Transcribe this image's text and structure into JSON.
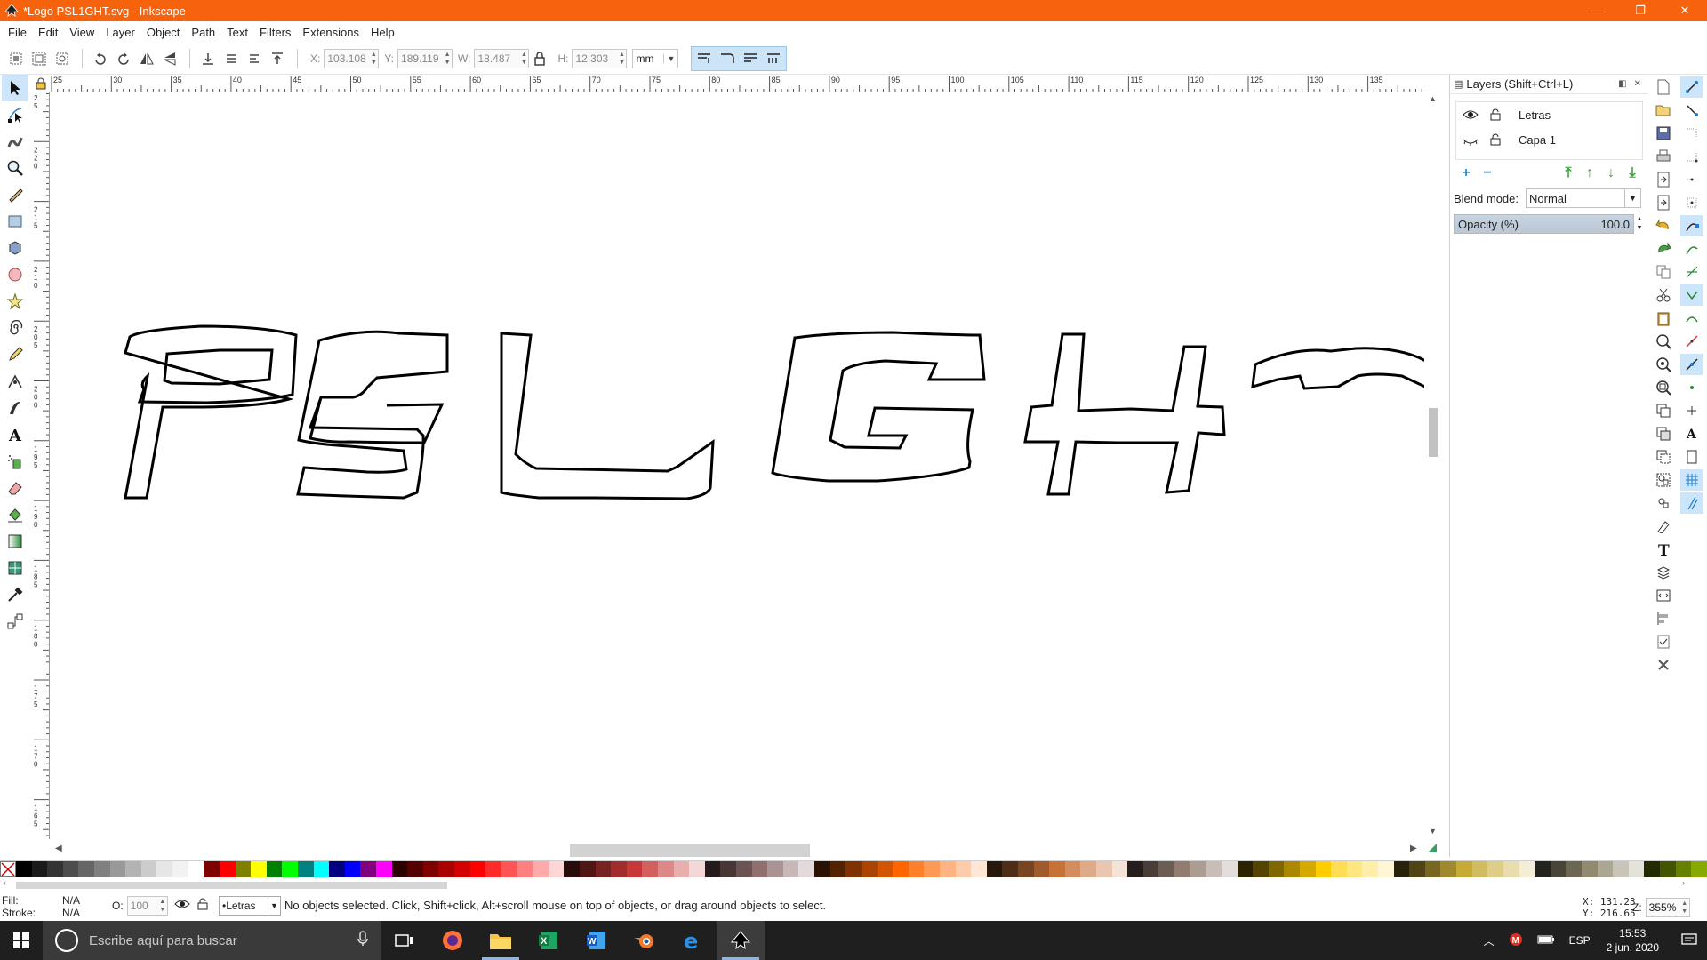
{
  "window": {
    "title": "*Logo PSL1GHT.svg - Inkscape",
    "controls": {
      "minimize": "—",
      "restore": "❐",
      "close": "✕"
    }
  },
  "menu": [
    "File",
    "Edit",
    "View",
    "Layer",
    "Object",
    "Path",
    "Text",
    "Filters",
    "Extensions",
    "Help"
  ],
  "toolcontrols": {
    "x_label": "X:",
    "x_value": "103.108",
    "y_label": "Y:",
    "y_value": "189.119",
    "w_label": "W:",
    "w_value": "18.487",
    "h_label": "H:",
    "h_value": "12.303",
    "unit": "mm"
  },
  "rulers": {
    "top_ticks": [
      "25",
      "30",
      "35",
      "40",
      "45",
      "50",
      "55",
      "60",
      "65",
      "70",
      "75",
      "80",
      "85",
      "90",
      "95",
      "100",
      "105",
      "110",
      "115",
      "120",
      "125",
      "130",
      "135"
    ],
    "left_ticks": [
      "225",
      "220",
      "215",
      "210",
      "205",
      "200",
      "195",
      "190",
      "185",
      "180",
      "175",
      "170",
      "165"
    ]
  },
  "canvas": {
    "artwork_text": "PSL GHT"
  },
  "layers_dialog": {
    "title": "Layers (Shift+Ctrl+L)",
    "layers": [
      {
        "name": "Letras",
        "visible": true,
        "locked": false
      },
      {
        "name": "Capa 1",
        "visible": false,
        "locked": false
      }
    ],
    "blend_label": "Blend mode:",
    "blend_value": "Normal",
    "opacity_label": "Opacity (%)",
    "opacity_value": "100.0"
  },
  "palette_colors": [
    "#000000",
    "#1a1a1a",
    "#333333",
    "#4d4d4d",
    "#666666",
    "#808080",
    "#999999",
    "#b3b3b3",
    "#cccccc",
    "#e6e6e6",
    "#f2f2f2",
    "#ffffff",
    "#800000",
    "#ff0000",
    "#808000",
    "#ffff00",
    "#008000",
    "#00ff00",
    "#008080",
    "#00ffff",
    "#000080",
    "#0000ff",
    "#800080",
    "#ff00ff",
    "#2b0000",
    "#550000",
    "#800000",
    "#aa0000",
    "#d40000",
    "#ff0000",
    "#ff2a2a",
    "#ff5555",
    "#ff8080",
    "#ffaaaa",
    "#ffd5d5",
    "#280b0b",
    "#501616",
    "#782121",
    "#a02c2c",
    "#c83737",
    "#d35f5f",
    "#de8787",
    "#e9afaf",
    "#f4d7d7",
    "#241c1c",
    "#483737",
    "#6c5353",
    "#916f6f",
    "#ac9393",
    "#c8b7b7",
    "#e3dbdb",
    "#2b1100",
    "#552200",
    "#803300",
    "#aa4400",
    "#d45500",
    "#ff6600",
    "#ff7f2a",
    "#ff9955",
    "#ffb380",
    "#ffccaa",
    "#ffe6d5",
    "#28170b",
    "#502d16",
    "#784421",
    "#a05a2c",
    "#c87137",
    "#d38d5f",
    "#deaa87",
    "#e9c6af",
    "#f4e3d7",
    "#241f1c",
    "#483e37",
    "#6c5d53",
    "#917c6f",
    "#ac9d93",
    "#c8beb7",
    "#e3dedb",
    "#2b2200",
    "#554400",
    "#806600",
    "#aa8800",
    "#d4aa00",
    "#ffcc00",
    "#ffdd55",
    "#ffe680",
    "#ffeeaa",
    "#fff6d5",
    "#28220b",
    "#504416",
    "#786721",
    "#a0892c",
    "#c8ab37",
    "#d3bc5f",
    "#decd87",
    "#e9ddaf",
    "#f4eed7",
    "#24221c",
    "#484537",
    "#6c6753",
    "#918a6f",
    "#aca793",
    "#c8c4b7",
    "#e3e2db",
    "#222b00",
    "#445500",
    "#668000",
    "#88aa00"
  ],
  "statusbar": {
    "fill_label": "Fill:",
    "fill_value": "N/A",
    "stroke_label": "Stroke:",
    "stroke_value": "N/A",
    "opacity_label": "O:",
    "opacity_value": "100",
    "layer": "•Letras",
    "message": "No objects selected. Click, Shift+click, Alt+scroll mouse on top of objects, or drag around objects to select.",
    "x_coord": "X:  131.23",
    "y_coord": "Y:  216.65",
    "zoom_label": "Z:",
    "zoom_value": "355%"
  },
  "taskbar": {
    "search_placeholder": "Escribe aquí para buscar",
    "language": "ESP",
    "time": "15:53",
    "date": "2 jun. 2020"
  }
}
